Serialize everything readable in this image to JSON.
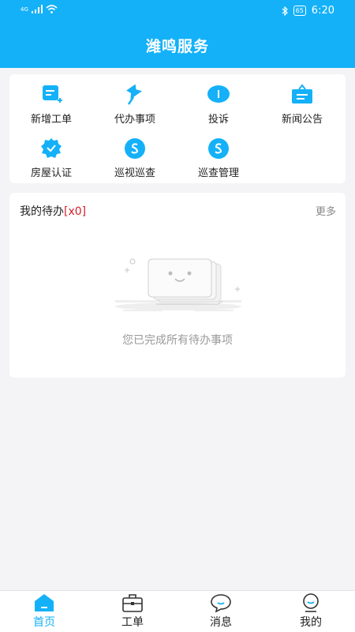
{
  "status_bar": {
    "signal": "4G",
    "battery": "65",
    "time": "6:20"
  },
  "header": {
    "title": "潍鸣服务"
  },
  "grid": {
    "items": [
      {
        "label": "新增工单",
        "icon": "new-order-icon"
      },
      {
        "label": "代办事项",
        "icon": "pin-icon"
      },
      {
        "label": "投诉",
        "icon": "complaint-icon"
      },
      {
        "label": "新闻公告",
        "icon": "news-icon"
      },
      {
        "label": "房屋认证",
        "icon": "house-verify-icon"
      },
      {
        "label": "巡视巡查",
        "icon": "patrol-icon"
      },
      {
        "label": "巡查管理",
        "icon": "patrol-manage-icon"
      }
    ]
  },
  "todo": {
    "title": "我的待办",
    "count": "[x0]",
    "more": "更多",
    "empty_text": "您已完成所有待办事项"
  },
  "tabbar": {
    "items": [
      {
        "label": "首页",
        "icon": "home-icon",
        "active": true
      },
      {
        "label": "工单",
        "icon": "briefcase-icon",
        "active": false
      },
      {
        "label": "消息",
        "icon": "message-icon",
        "active": false
      },
      {
        "label": "我的",
        "icon": "profile-icon",
        "active": false
      }
    ]
  },
  "colors": {
    "primary": "#14b1f8",
    "count": "#d4202a",
    "background": "#f4f4f6"
  }
}
